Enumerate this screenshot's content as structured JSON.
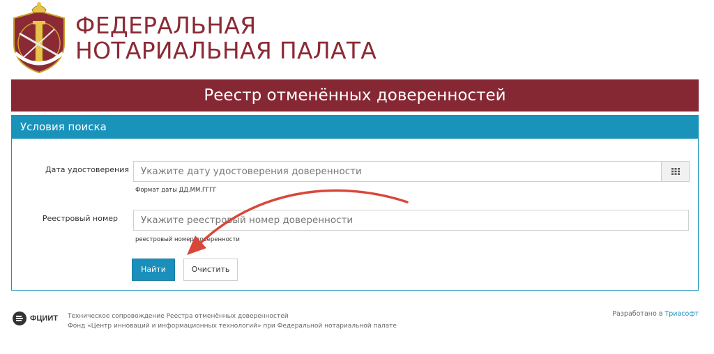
{
  "header": {
    "org_line1": "ФЕДЕРАЛЬНАЯ",
    "org_line2": "НОТАРИАЛЬНАЯ ПАЛАТА"
  },
  "title_bar": {
    "title": "Реестр отменённых доверенностей"
  },
  "search_panel": {
    "heading": "Условия поиска",
    "date_field": {
      "label": "Дата удостоверения",
      "placeholder": "Укажите дату удостоверения доверенности",
      "value": "",
      "hint": "Формат даты ДД.ММ.ГГГГ"
    },
    "reg_field": {
      "label": "Реестровый номер",
      "placeholder": "Укажите реестровый номер доверенности",
      "value": "",
      "hint": "реестровый номер доверенности"
    },
    "find_label": "Найти",
    "clear_label": "Очистить"
  },
  "footer": {
    "logo_label": "ФЦИИТ",
    "line1": "Техническое сопровождение Реестра отменённых доверенностей",
    "line2": "Фонд «Центр инноваций и информационных технологий» при Федеральной нотариальной палате",
    "developed_prefix": "Разработано в",
    "developer": "Триасофт"
  },
  "colors": {
    "brand": "#862834",
    "accent": "#1a93bb"
  },
  "icons": {
    "calendar": "calendar-grid-icon",
    "emblem": "notary-emblem-icon",
    "footer_logo": "fciit-logo-icon"
  }
}
